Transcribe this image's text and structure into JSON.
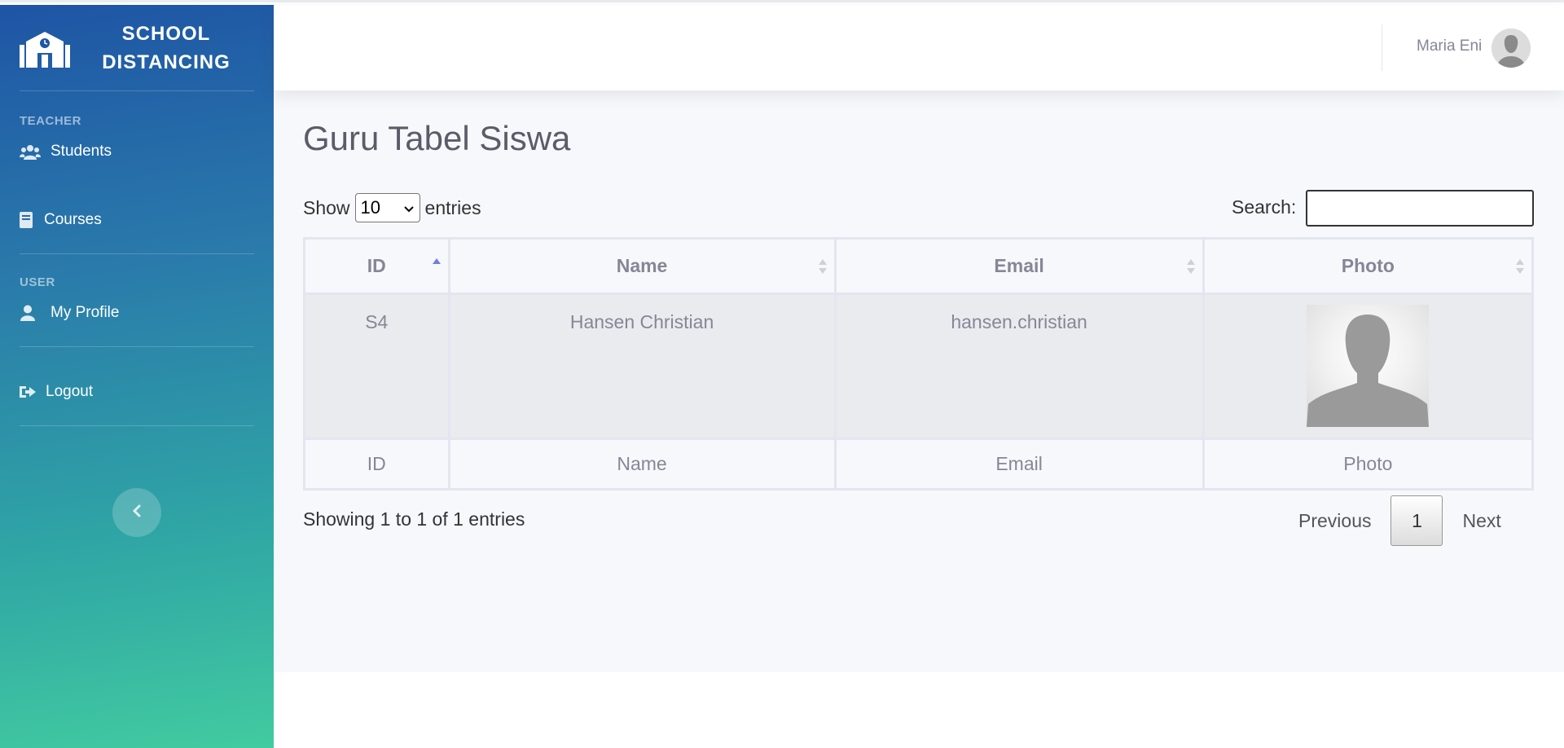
{
  "brand": {
    "title": "SCHOOL DISTANCING",
    "icon": "school-icon"
  },
  "sidebar": {
    "sections": [
      {
        "heading": "TEACHER",
        "items": [
          {
            "label": "Students",
            "icon": "users-icon"
          },
          {
            "label": "Courses",
            "icon": "book-icon"
          }
        ]
      },
      {
        "heading": "USER",
        "items": [
          {
            "label": "My Profile",
            "icon": "user-icon"
          }
        ]
      }
    ],
    "logout": {
      "label": "Logout",
      "icon": "sign-out-icon"
    },
    "toggle_icon": "chevron-left-icon"
  },
  "topbar": {
    "user_name": "Maria Eni"
  },
  "page": {
    "title": "Guru Tabel Siswa"
  },
  "table_controls": {
    "show_label": "Show",
    "entries_label": "entries",
    "length_value": "10",
    "search_label": "Search:",
    "search_value": ""
  },
  "table": {
    "columns": [
      "ID",
      "Name",
      "Email",
      "Photo"
    ],
    "sorted_column": "ID",
    "sort_direction": "ascending",
    "rows": [
      {
        "id": "S4",
        "name": "Hansen Christian",
        "email": "hansen.christian",
        "photo": "avatar-placeholder"
      }
    ],
    "footer": [
      "ID",
      "Name",
      "Email",
      "Photo"
    ]
  },
  "pagination": {
    "info": "Showing 1 to 1 of 1 entries",
    "previous": "Previous",
    "current_page": "1",
    "next": "Next"
  },
  "colors": {
    "sidebar_gradient_start": "#1e55a5",
    "sidebar_gradient_end": "#42cba0",
    "sort_active": "#6f7ce0",
    "content_bg": "#f7f8fc"
  }
}
